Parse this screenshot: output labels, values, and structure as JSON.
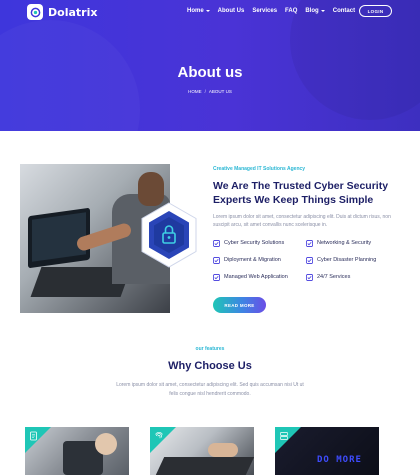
{
  "brand": {
    "name": "Dolatrix",
    "icon": "logo-mark-icon"
  },
  "nav": {
    "items": [
      {
        "label": "Home",
        "has_dropdown": true
      },
      {
        "label": "About Us",
        "has_dropdown": false
      },
      {
        "label": "Services",
        "has_dropdown": false
      },
      {
        "label": "FAQ",
        "has_dropdown": false
      },
      {
        "label": "Blog",
        "has_dropdown": true
      },
      {
        "label": "Contact",
        "has_dropdown": false
      }
    ],
    "login_label": "LOGIN"
  },
  "hero": {
    "title": "About us",
    "breadcrumb": [
      "HOME",
      "ABOUT US"
    ]
  },
  "about": {
    "kicker": "Creative Managed IT Solutions Agency",
    "heading": "We Are The Trusted Cyber Security Experts We Keep Things Simple",
    "description": "Lorem ipsum dolor sit amet, consectetur adipiscing elit. Duis at dictum risus, non suscipit arcu, sit amet convallis nunc scelerisque in.",
    "features": [
      "Cyber Security Solutions",
      "Networking & Security",
      "Diployment & Migration",
      "Cyber Disaster Planning",
      "Managed Web Application",
      "24/7 Services"
    ],
    "read_more_label": "READ MORE"
  },
  "features_section": {
    "kicker": "our features",
    "title": "Why Choose Us",
    "description": "Lorem ipsum dolor sit amet, consectetur adipiscing elit. Sed quis accumsan nisi Ut ut felis congue nisl hendrerit commodo."
  },
  "cards": [
    {
      "icon": "document-shield-icon"
    },
    {
      "icon": "fingerprint-icon"
    },
    {
      "icon": "server-icon",
      "screen_text": "DO MORE"
    }
  ],
  "colors": {
    "hero_primary": "#3e36dc",
    "accent_teal": "#1fc6b6",
    "accent_cyan": "#2ab7d4",
    "heading_navy": "#1d1f66",
    "button_gradient_end": "#6a4ee6"
  }
}
